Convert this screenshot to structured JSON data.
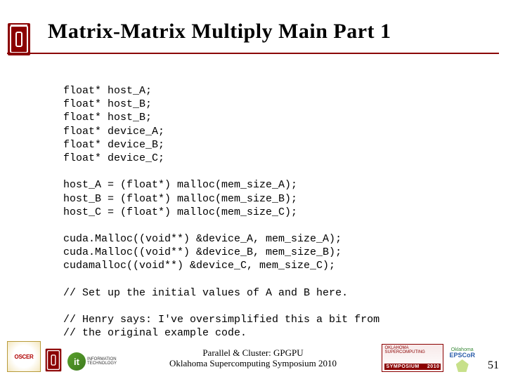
{
  "title": "Matrix-Matrix Multiply Main Part 1",
  "code": "float* host_A;\nfloat* host_B;\nfloat* host_B;\nfloat* device_A;\nfloat* device_B;\nfloat* device_C;\n\nhost_A = (float*) malloc(mem_size_A);\nhost_B = (float*) malloc(mem_size_B);\nhost_C = (float*) malloc(mem_size_C);\n\ncuda.Malloc((void**) &device_A, mem_size_A);\ncuda.Malloc((void**) &device_B, mem_size_B);\ncudamalloc((void**) &device_C, mem_size_C);\n\n// Set up the initial values of A and B here.\n\n// Henry says: I've oversimplified this a bit from\n// the original example code.",
  "footer": {
    "center_line1": "Parallel & Cluster: GPGPU",
    "center_line2": "Oklahoma Supercomputing Symposium 2010"
  },
  "logos": {
    "oscer": "OSCER",
    "it_abbr": "it",
    "it_line1": "INFORMATION",
    "it_line2": "TECHNOLOGY",
    "symposium_top": "OKLAHOMA SUPERCOMPUTING",
    "symposium_label": "SYMPOSIUM",
    "symposium_year": "2010",
    "epscor_top": "Oklahoma",
    "epscor_main": "EPSCoR"
  },
  "page_number": "51"
}
